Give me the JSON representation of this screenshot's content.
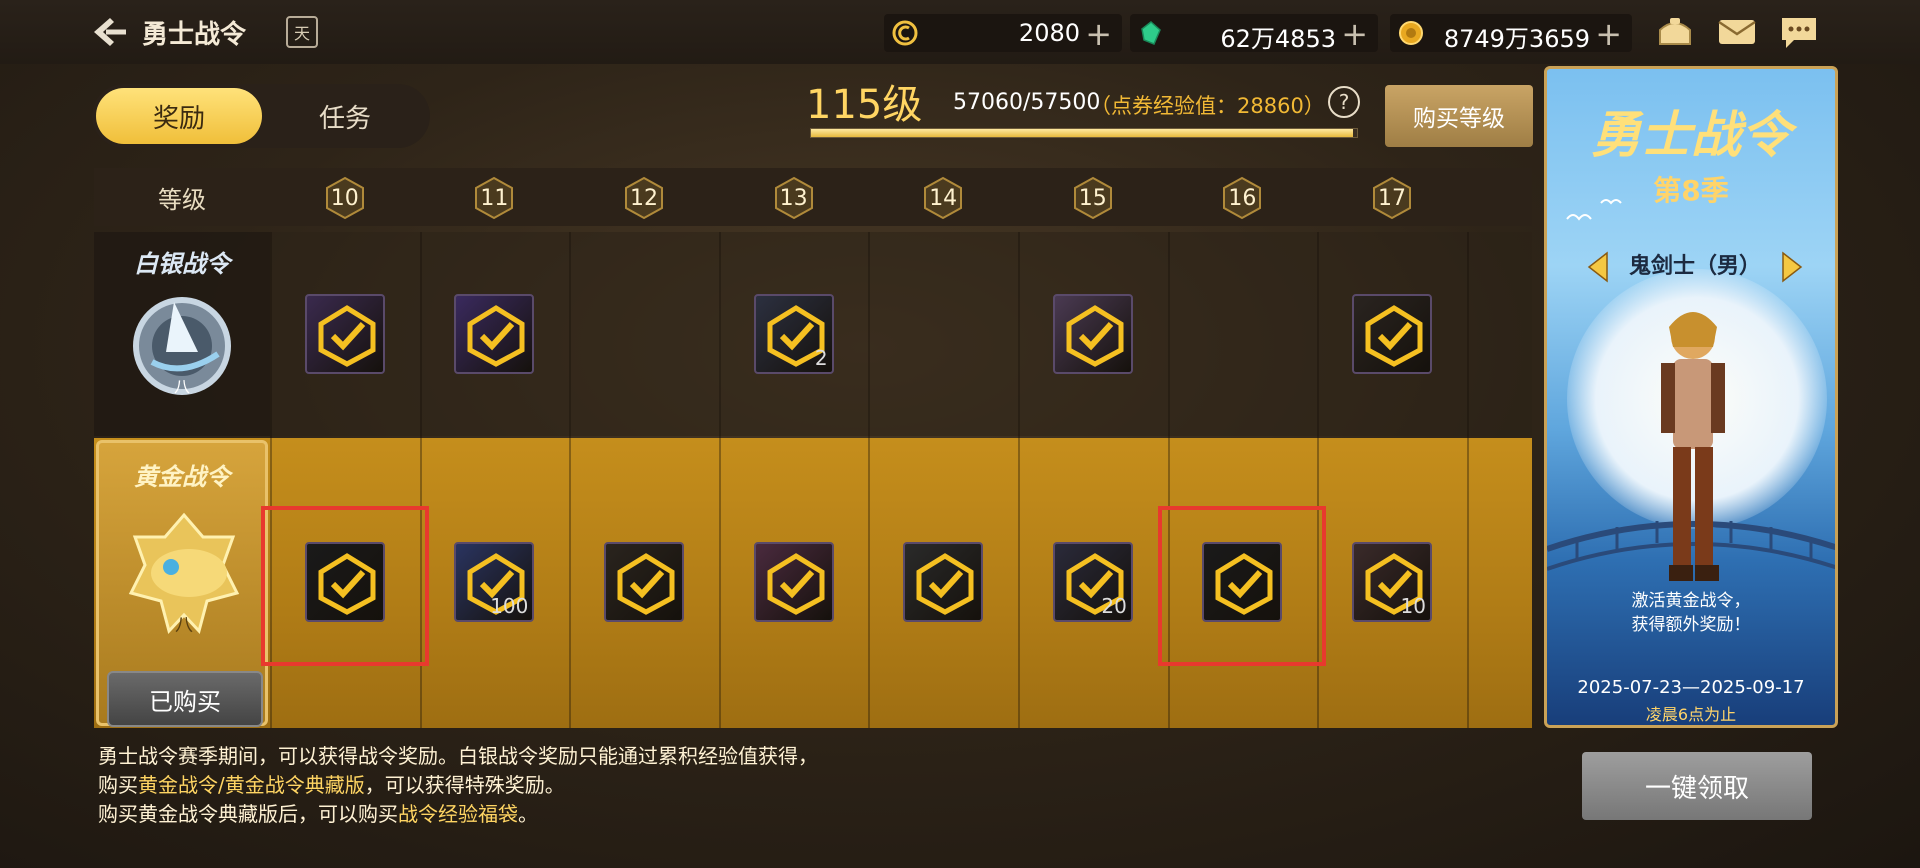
{
  "header": {
    "title": "勇士战令",
    "calendar_glyph": "天",
    "currencies": [
      {
        "icon": "coupon-currency-icon",
        "amount": "2080",
        "color": "#f0c040"
      },
      {
        "icon": "green-crystal-icon",
        "amount": "62万4853",
        "color": "#2ecc8a"
      },
      {
        "icon": "gold-coin-icon",
        "amount": "8749万3659",
        "color": "#e8a820"
      }
    ],
    "plus": "+",
    "icons": [
      "shop-icon",
      "mail-icon",
      "chat-icon"
    ]
  },
  "tabs": {
    "rewards": "奖励",
    "tasks": "任务"
  },
  "level": {
    "label": "115级",
    "exp": "57060/57500",
    "extra": "（点券经验值：28860）",
    "progress": 0.992,
    "help": "?",
    "buy_label": "购买等级"
  },
  "grid": {
    "header_label": "等级",
    "levels": [
      "10",
      "11",
      "12",
      "13",
      "14",
      "15",
      "16",
      "17"
    ],
    "silver_title": "白银战令",
    "gold_title": "黄金战令",
    "bought_label": "已购买",
    "silver_items": [
      {
        "present": true,
        "qty": "",
        "color": "#3a2a4e"
      },
      {
        "present": true,
        "qty": "",
        "color": "#3a2a5e"
      },
      {
        "present": false
      },
      {
        "present": true,
        "qty": "2",
        "color": "#2c3040"
      },
      {
        "present": false
      },
      {
        "present": true,
        "qty": "",
        "color": "#4a3a52"
      },
      {
        "present": false
      },
      {
        "present": true,
        "qty": "",
        "color": "#2a2420"
      }
    ],
    "gold_items": [
      {
        "qty": "",
        "color": "#1a1a1a",
        "highlighted": true
      },
      {
        "qty": "100",
        "color": "#2a3460",
        "highlighted": false
      },
      {
        "qty": "",
        "color": "#2a241e",
        "highlighted": false
      },
      {
        "qty": "",
        "color": "#4a2a3e",
        "highlighted": false
      },
      {
        "qty": "",
        "color": "#2a2a2a",
        "highlighted": false
      },
      {
        "qty": "20",
        "color": "#2a2a3a",
        "highlighted": false
      },
      {
        "qty": "",
        "color": "#1a1a1a",
        "highlighted": true
      },
      {
        "qty": "10",
        "color": "#3a2a2a",
        "highlighted": false
      }
    ]
  },
  "panel": {
    "title": "勇士战令",
    "season": "第8季",
    "character_name": "鬼剑士（男）",
    "activate_line1": "激活黄金战令，",
    "activate_line2": "获得额外奖励！",
    "dates": "2025-07-23—2025-09-17",
    "deadline": "凌晨6点为止"
  },
  "notes": {
    "line1a": "勇士战令赛季期间，可以获得战令奖励。白银战令奖励只能通过累积经验值获得，",
    "line2a": "购买",
    "line2b": "黄金战令/黄金战令典藏版",
    "line2c": "，可以获得特殊奖励。",
    "line3a": "购买黄金战令典藏版后，可以购买",
    "line3b": "战令经验福袋",
    "line3c": "。"
  },
  "claim_label": "一键领取"
}
